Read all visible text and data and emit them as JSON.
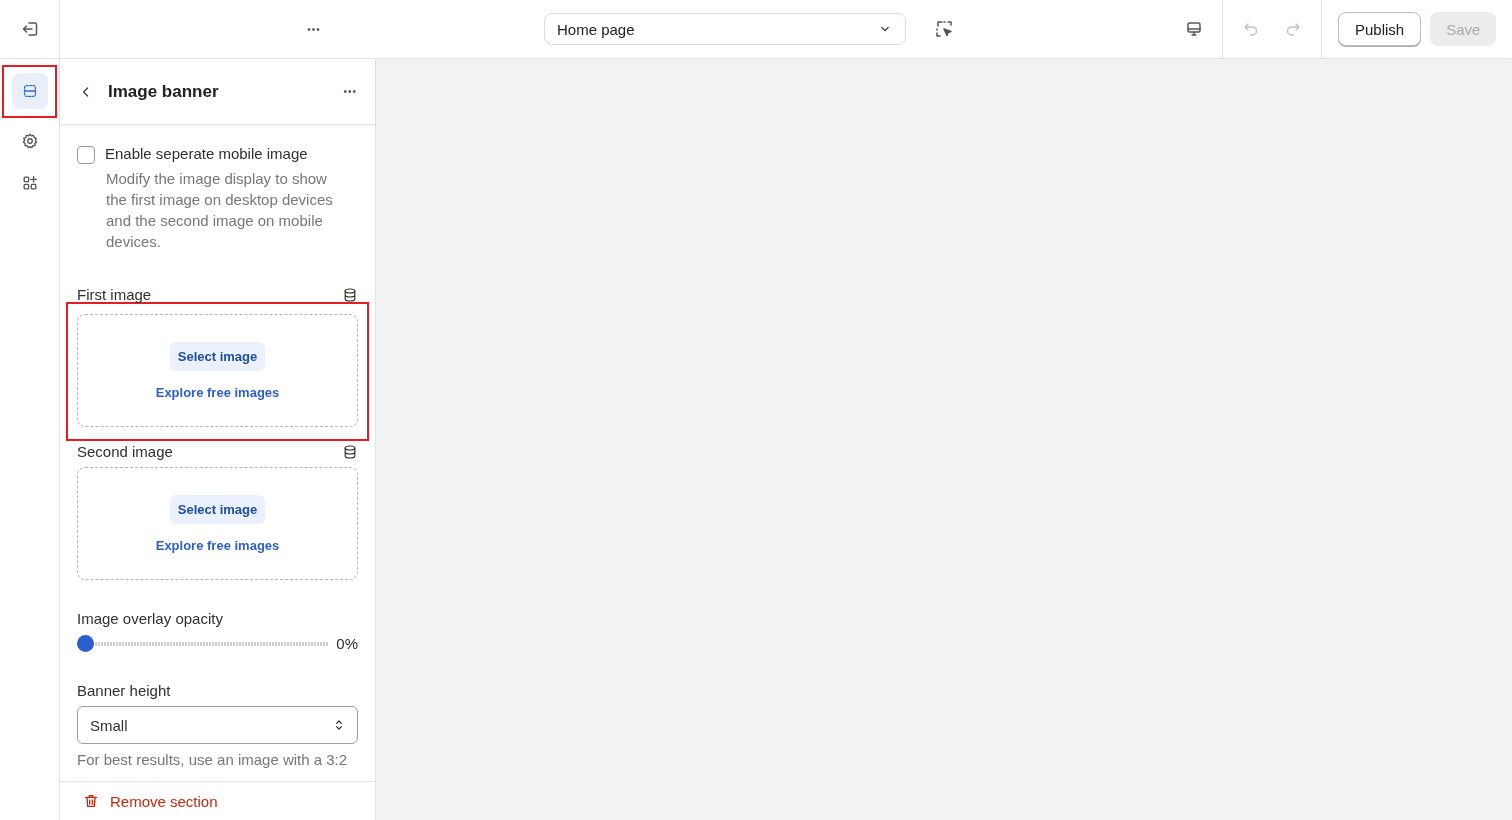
{
  "topbar": {
    "menu_label": "•••",
    "page_select": {
      "value": "Home page"
    },
    "undo_disabled": true,
    "redo_disabled": true,
    "buttons": [
      {
        "label": "Publish",
        "kind": "outline",
        "disabled": false
      },
      {
        "label": "Save",
        "kind": "filled",
        "disabled": true
      }
    ]
  },
  "rail": {
    "items": [
      {
        "kind": "sections",
        "selected": true,
        "highlighted": true
      },
      {
        "kind": "settings",
        "selected": false,
        "highlighted": false
      },
      {
        "kind": "apps",
        "selected": false,
        "highlighted": false
      }
    ]
  },
  "panel": {
    "title": "Image banner",
    "more_label": "•••",
    "checkbox": {
      "label": "Enable seperate mobile image",
      "checked": false,
      "help": "Modify the image display to show the first image on desktop devices and the second image on mobile devices."
    },
    "images": [
      {
        "label": "First image",
        "select": "Select image",
        "explore": "Explore free images",
        "highlighted": true
      },
      {
        "label": "Second image",
        "select": "Select image",
        "explore": "Explore free images",
        "highlighted": false
      }
    ],
    "slider": {
      "label": "Image overlay opacity",
      "level": 0,
      "reading": "0%"
    },
    "height": {
      "label": "Banner height",
      "value": "Small",
      "help": "For best results, use an image with a 3:2"
    },
    "remove": "Remove section"
  }
}
